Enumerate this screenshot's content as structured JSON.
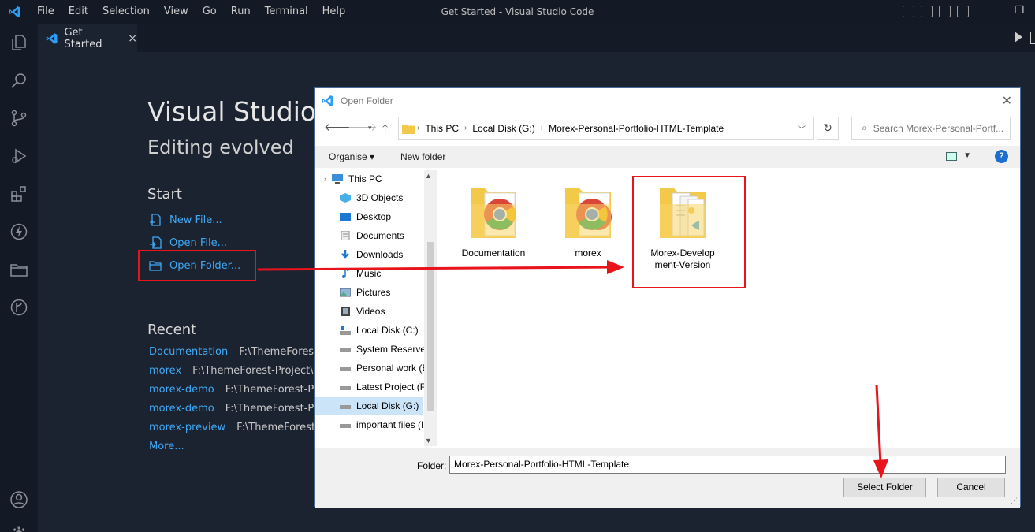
{
  "menu": [
    "File",
    "Edit",
    "Selection",
    "View",
    "Go",
    "Run",
    "Terminal",
    "Help"
  ],
  "window_title": "Get Started - Visual Studio Code",
  "tab": {
    "label": "Get Started",
    "close": "×"
  },
  "welcome": {
    "title": "Visual Studio Code",
    "subtitle": "Editing evolved",
    "start_heading": "Start",
    "start_items": [
      "New File...",
      "Open File...",
      "Open Folder..."
    ],
    "recent_heading": "Recent",
    "recent": [
      {
        "name": "Documentation",
        "path": "F:\\ThemeForest-Pr"
      },
      {
        "name": "morex",
        "path": "F:\\ThemeForest-Project\\HTM"
      },
      {
        "name": "morex-demo",
        "path": "F:\\ThemeForest-Proje"
      },
      {
        "name": "morex-demo",
        "path": "F:\\ThemeForest-Proje"
      },
      {
        "name": "morex-preview",
        "path": "F:\\ThemeForest-Proje"
      }
    ],
    "more": "More..."
  },
  "dialog": {
    "title": "Open Folder",
    "close": "✕",
    "breadcrumb": [
      "This PC",
      "Local Disk (G:)",
      "Morex-Personal-Portfolio-HTML-Template"
    ],
    "search_placeholder": "Search Morex-Personal-Portf...",
    "organise": "Organise ▾",
    "new_folder": "New folder",
    "help": "?",
    "nav_items": [
      "This PC",
      "3D Objects",
      "Desktop",
      "Documents",
      "Downloads",
      "Music",
      "Pictures",
      "Videos",
      "Local Disk (C:)",
      "System Reserved",
      "Personal work (E",
      "Latest Project (F:",
      "Local Disk (G:)",
      "important files (I"
    ],
    "selected_nav": "Local Disk (G:)",
    "files": [
      {
        "name": "Documentation",
        "type": "chrome-folder"
      },
      {
        "name": "morex",
        "type": "chrome-folder"
      },
      {
        "name": "Morex-Develop ment-Version",
        "type": "vscode-folder"
      }
    ],
    "folder_label": "Folder:",
    "folder_value": "Morex-Personal-Portfolio-HTML-Template",
    "select_button": "Select Folder",
    "cancel_button": "Cancel"
  },
  "colors": {
    "accent_link": "#3fa9f5",
    "annotation_red": "#e8131b",
    "editor_bg": "#1b2230",
    "chrome_bg": "#141a25",
    "folder_yellow": "#f3c94a"
  }
}
